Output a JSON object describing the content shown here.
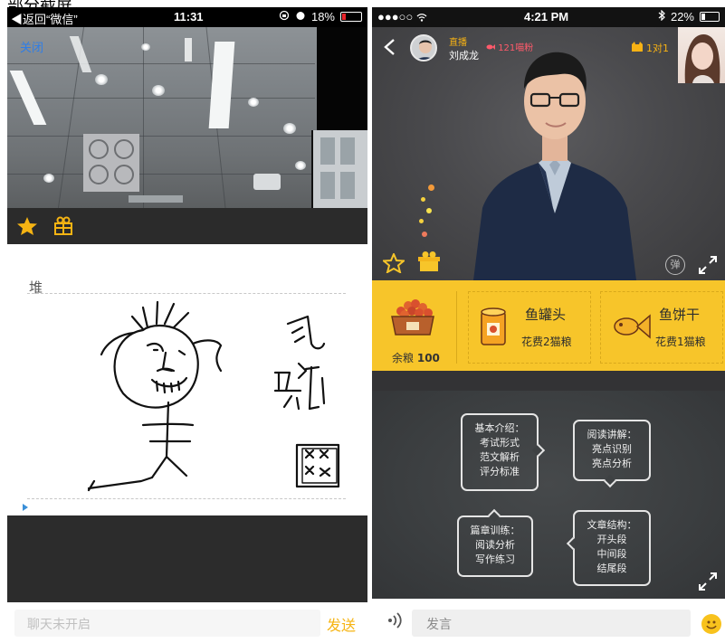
{
  "caption": "部分截屏，",
  "left": {
    "status_bar": {
      "back": "◀返回“微信”",
      "time": "11:31",
      "battery": "18%",
      "icons": [
        "lock-rotation-icon",
        "alarm-icon"
      ]
    },
    "video": {
      "close": "关闭"
    },
    "toolbar": {
      "icons": [
        "star-icon",
        "gift-icon"
      ]
    },
    "board": {
      "title": "堆"
    },
    "chat": {
      "placeholder": "聊天未开启",
      "send": "发送"
    }
  },
  "right": {
    "status_bar": {
      "signal": "●●●○○",
      "time": "4:21 PM",
      "battery": "22%",
      "icons": [
        "wifi-icon",
        "bluetooth-icon"
      ]
    },
    "header": {
      "live_tag": "直播",
      "host_name": "刘成龙",
      "fans": "121喵粉",
      "mode": "1对1"
    },
    "overlay": {
      "danmu": "弹"
    },
    "shop": {
      "balance_label": "余粮",
      "balance_value": "100",
      "items": [
        {
          "name": "鱼罐头",
          "cost": "花费2猫粮"
        },
        {
          "name": "鱼饼干",
          "cost": "花费1猫粮"
        }
      ]
    },
    "board": {
      "notes": [
        {
          "lines": [
            "基本介绍：",
            "考试形式",
            "范文解析",
            "评分标准"
          ]
        },
        {
          "lines": [
            "阅读讲解：",
            "亮点识别",
            "亮点分析"
          ]
        },
        {
          "lines": [
            "篇章训练：",
            "阅读分析",
            "写作练习"
          ]
        },
        {
          "lines": [
            "文章结构：",
            "开头段",
            "中间段",
            "结尾段"
          ]
        }
      ]
    },
    "chat": {
      "placeholder": "发言"
    }
  },
  "colors": {
    "accent_yellow": "#f7c52a",
    "link_blue": "#2d7de8",
    "battery_red": "#e8232a",
    "dark_panel": "#2b2b2b"
  }
}
